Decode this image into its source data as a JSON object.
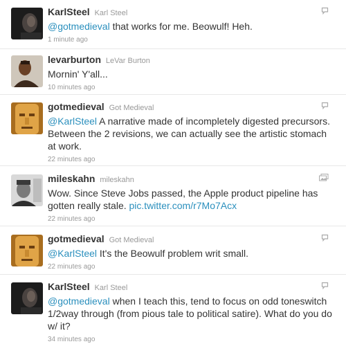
{
  "colors": {
    "link": "#2a8fbd",
    "text": "#333333",
    "meta": "#999999",
    "divider": "#e8e8e8"
  },
  "tweets": [
    {
      "screen_name": "KarlSteel",
      "full_name": "Karl Steel",
      "mention": "@gotmedieval",
      "text": " that works for me. Beowulf! Heh.",
      "time": "1 minute ago",
      "icon": "reply-bubble-icon"
    },
    {
      "screen_name": "levarburton",
      "full_name": "LeVar Burton",
      "text": "Mornin' Y'all...",
      "time": "10 minutes ago"
    },
    {
      "screen_name": "gotmedieval",
      "full_name": "Got Medieval",
      "mention": "@KarlSteel",
      "text": " A narrative made of incompletely digested precursors. Between the 2 revisions, we can actually see the artistic stomach at work.",
      "time": "22 minutes ago",
      "icon": "reply-bubble-icon"
    },
    {
      "screen_name": "mileskahn",
      "full_name": "mileskahn",
      "text": "Wow. Since Steve Jobs passed, the Apple product pipeline has gotten really stale. ",
      "link": "pic.twitter.com/r7Mo7Acx",
      "time": "22 minutes ago",
      "icon": "media-icon"
    },
    {
      "screen_name": "gotmedieval",
      "full_name": "Got Medieval",
      "mention": "@KarlSteel",
      "text": " It's the Beowulf problem writ small.",
      "time": "22 minutes ago",
      "icon": "reply-bubble-icon"
    },
    {
      "screen_name": "KarlSteel",
      "full_name": "Karl Steel",
      "mention": "@gotmedieval",
      "text": " when I teach this, tend to focus on odd toneswitch 1/2way through (from pious tale to political satire). What do you do w/ it?",
      "time": "34 minutes ago",
      "icon": "reply-bubble-icon"
    }
  ]
}
